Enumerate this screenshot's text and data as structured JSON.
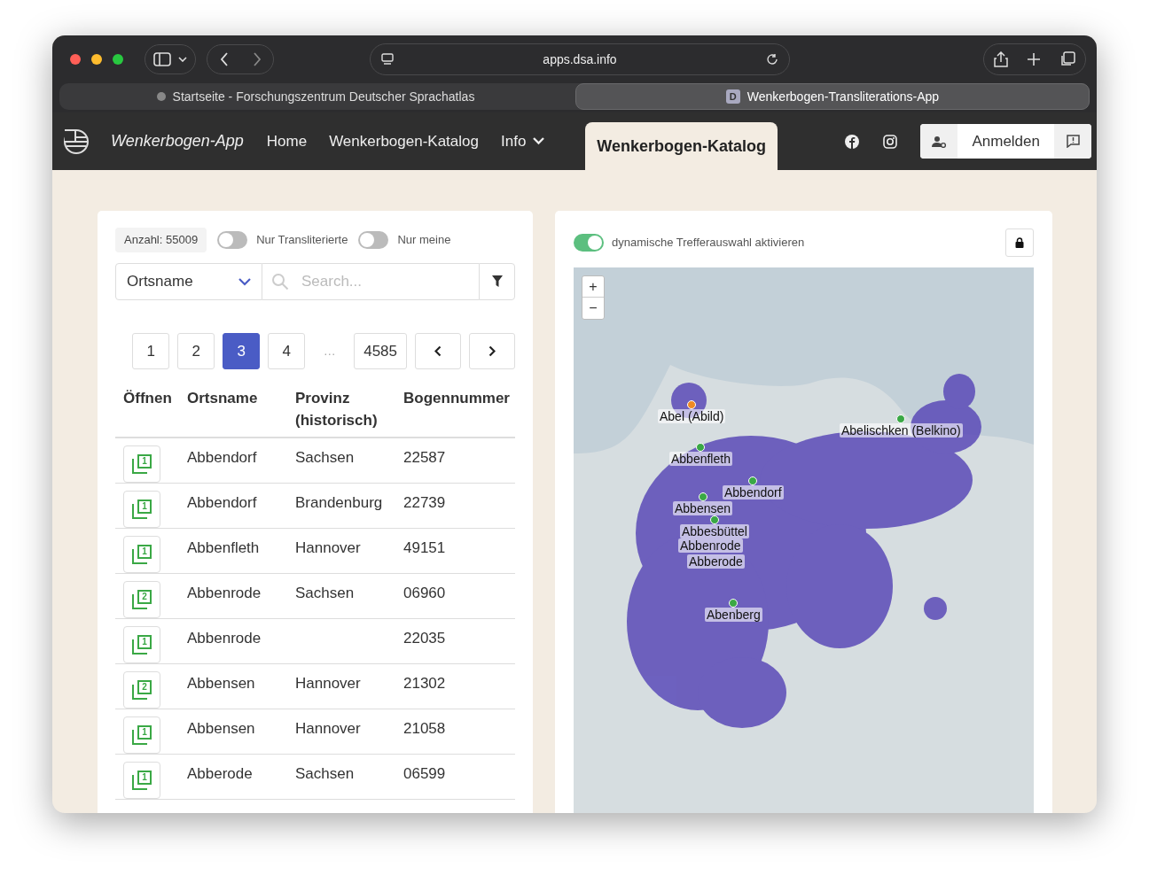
{
  "browser": {
    "address": "apps.dsa.info",
    "tabs": [
      {
        "label": "Startseite - Forschungszentrum Deutscher Sprachatlas",
        "selected": false
      },
      {
        "label": "Wenkerbogen-Transliterations-App",
        "favicon": "D",
        "selected": true
      }
    ]
  },
  "navbar": {
    "brand": "Wenkerbogen-App",
    "links": [
      {
        "label": "Home",
        "dropdown": false
      },
      {
        "label": "Wenkerbogen-Katalog",
        "dropdown": false
      },
      {
        "label": "Info",
        "dropdown": true
      }
    ],
    "page_tab": "Wenkerbogen-Katalog",
    "login": "Anmelden"
  },
  "list_panel": {
    "count": "Anzahl: 55009",
    "toggles": [
      {
        "label": "Nur Transliterierte",
        "on": false
      },
      {
        "label": "Nur meine",
        "on": false
      }
    ],
    "field_select": "Ortsname",
    "search": {
      "placeholder": "Search..."
    },
    "pages": [
      {
        "label": "1",
        "selected": false
      },
      {
        "label": "2",
        "selected": false
      },
      {
        "label": "3",
        "selected": true
      },
      {
        "label": "4",
        "selected": false
      },
      {
        "label": "…",
        "kind": "gap"
      },
      {
        "label": "4585",
        "selected": false
      }
    ],
    "columns": [
      "Öffnen",
      "Ortsname",
      "Provinz (historisch)",
      "Bogennummer"
    ],
    "rows": [
      {
        "copies": "1",
        "ort": "Abbendorf",
        "provinz": "Sachsen",
        "bogen": "22587"
      },
      {
        "copies": "1",
        "ort": "Abbendorf",
        "provinz": "Brandenburg",
        "bogen": "22739"
      },
      {
        "copies": "1",
        "ort": "Abbenfleth",
        "provinz": "Hannover",
        "bogen": "49151"
      },
      {
        "copies": "2",
        "ort": "Abbenrode",
        "provinz": "Sachsen",
        "bogen": "06960"
      },
      {
        "copies": "1",
        "ort": "Abbenrode",
        "provinz": "",
        "bogen": "22035"
      },
      {
        "copies": "2",
        "ort": "Abbensen",
        "provinz": "Hannover",
        "bogen": "21302"
      },
      {
        "copies": "1",
        "ort": "Abbensen",
        "provinz": "Hannover",
        "bogen": "21058"
      },
      {
        "copies": "1",
        "ort": "Abberode",
        "provinz": "Sachsen",
        "bogen": "06599"
      }
    ]
  },
  "map_panel": {
    "dynamic_toggle": {
      "label": "dynamische Trefferauswahl aktivieren",
      "on": true
    },
    "zoom": [
      "+",
      "−"
    ],
    "markers": [
      {
        "label": "Abel (Abild)",
        "color": "#f08a24"
      },
      {
        "label": "Abelischken (Belkino)",
        "color": "#3aa845"
      },
      {
        "label": "Abbenfleth",
        "color": "#3aa845"
      },
      {
        "label": "Abbendorf",
        "color": "#3aa845"
      },
      {
        "label": "Abbensen",
        "color": "#3aa845"
      },
      {
        "label": "Abbesbüttel",
        "color": "#3aa845"
      },
      {
        "label": "Abbenrode"
      },
      {
        "label": "Abberode"
      },
      {
        "label": "Abenberg",
        "color": "#3aa845"
      }
    ]
  }
}
